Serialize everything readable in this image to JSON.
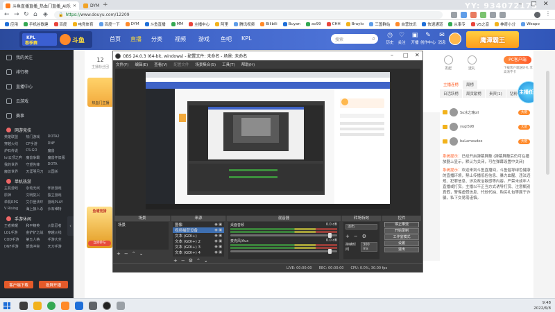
{
  "browser": {
    "tabs": [
      {
        "label": "斗鱼直播直播_热血门直播_AI乐",
        "active": true
      },
      {
        "label": "DYM",
        "active": false
      }
    ],
    "url": "https://www.douyu.com/12209",
    "url_prefix": "https://",
    "url_host": "www.douyu.com/12209",
    "bookmarks": [
      "应用",
      "手机谷歌建",
      "百度",
      "电竞体育",
      "百度一下",
      "DYM",
      "斗鱼直播",
      "MM",
      "主播中心",
      "阿里",
      "腾讯视频",
      "Bilibili",
      "Buyan",
      "av99",
      "CHH",
      "Braylo",
      "三国群站",
      "自营快讯",
      "快速通道",
      "从事专",
      "V5之音",
      "神奇小分",
      "Weapo"
    ]
  },
  "douyu": {
    "nav": [
      "首页",
      "直播",
      "分类",
      "视频",
      "游戏",
      "鱼吧",
      "KPL"
    ],
    "search_placeholder": "搜索",
    "header_icons": [
      "历史",
      "关注",
      "开播",
      "创作中心",
      "消息",
      "直播助手"
    ],
    "banner_right": "鹰潭霸王"
  },
  "sidebar": {
    "items": [
      "我的关注",
      "排行榜",
      "直播中心",
      "云游戏",
      "赛事"
    ],
    "sections": [
      {
        "title": "网游竞技",
        "games": [
          "英雄联盟",
          "热门游戏",
          "DOTA2",
          "穿越火线",
          "CF手游",
          "DNF",
          "炉石传说",
          "CS:GO",
          "魔兽",
          "lol云顶之弈",
          "魔兽争霸",
          "魔兽怀旧服",
          "我的世界",
          "守望先锋",
          "DOTA",
          "魔兽世界",
          "天涯明月刀",
          "三国杀"
        ]
      },
      {
        "title": "单机热游",
        "games": [
          "主机游戏",
          "永劫无间",
          "怀旧游戏",
          "原神",
          "文明复兴",
          "独立游戏",
          "单机RPG",
          "艾尔登法环",
          "游戏PLAY",
          "V Rising",
          "海上狼人杀",
          "沙石维特"
        ]
      },
      {
        "title": "手游休闲",
        "games": [
          "王者荣耀",
          "和平精英",
          "火影忍者",
          "LOL手游",
          "金铲铲之战",
          "穿越火线",
          "COD手游",
          "第五人格",
          "手游大全",
          "DNF手游",
          "部落冲突",
          "天刀手游"
        ]
      }
    ],
    "buttons": [
      "客户端下载",
      "投屏开播"
    ]
  },
  "room": {
    "count": "12",
    "count_label": "主播粉丝团",
    "anchor_label": "热血门主播",
    "gift_title": "鱼塘竞猜",
    "gift_btn": "立即参与"
  },
  "obs": {
    "title": "OBS 24.0.3 (64-bit, windows) - 配置文件: 未命名 - 场景: 未命名",
    "menu": [
      {
        "label": "文件(F)",
        "enabled": true
      },
      {
        "label": "编辑(E)",
        "enabled": true
      },
      {
        "label": "查看(V)",
        "enabled": true
      },
      {
        "label": "配置文件",
        "enabled": false
      },
      {
        "label": "场景集合(S)",
        "enabled": true
      },
      {
        "label": "工具(T)",
        "enabled": true
      },
      {
        "label": "帮助(H)",
        "enabled": true
      }
    ],
    "docks": {
      "scenes": {
        "title": "场景",
        "items": [
          "场景"
        ]
      },
      "sources": {
        "title": "来源",
        "items": [
          "图像",
          "视频捕获设备",
          "文本 (GDI+)",
          "文本 (GDI+) 2",
          "文本 (GDI+) 3",
          "文本 (GDI+) 4"
        ]
      },
      "mixer": {
        "title": "混音器",
        "channels": [
          {
            "name": "桌面音频",
            "db": "0.0 dB"
          },
          {
            "name": "麦克风/Aux",
            "db": "0.0 dB"
          }
        ]
      },
      "transitions": {
        "title": "转场特效",
        "type": "淡出",
        "duration_label": "持续时间",
        "duration": "300 ms"
      },
      "controls": {
        "title": "控件",
        "buttons": [
          "停止推流",
          "开始录制",
          "工作室模式",
          "设置",
          "退出"
        ]
      }
    },
    "status": {
      "live": "LIVE: 00:00:00",
      "rec": "REC: 00:00:00",
      "cpu": "CPU: 0.0%, 30.00 fps"
    }
  },
  "right": {
    "top_icons": [
      "发起",
      "送礼"
    ],
    "pc_button": "PC客户端",
    "pc_sub": "下载客户端送好礼 享高清不卡",
    "tabs1": [
      "主播连榜",
      "周榜"
    ],
    "tabs2": [
      "日活跃榜",
      "周贡献榜",
      "贵宾(1)",
      "钻粉"
    ],
    "fans_badge": "主播任务",
    "fans": [
      {
        "name": "So冰之瑞oll",
        "level": "大佬"
      },
      {
        "name": "yugi598",
        "level": "大佬"
      },
      {
        "name": "baLameadee",
        "level": "大佬"
      }
    ],
    "chat": [
      {
        "tag": "系统提示：",
        "text": "已经开启弹幕屏蔽 (弹幕屏蔽后仍可在播放器上显示，默认为关闭，可在弹幕设置中关闭)"
      },
      {
        "tag": "系统提示：",
        "text": "欢迎来到斗鱼直播间，斗鱼倡导绿色健康的直播环境，禁止传播低俗信息、暴力血腥、违法违规、犯罪信息、涉及政治敏感等内容。严禁未成年人直播或打赏。主播以不正当方式诱导打赏、注意甄别真假，警惕虚假信息、代他代抽、购买礼包等属于诈骗，私下交易需谨慎。"
      }
    ]
  },
  "taskbar": {
    "time": "9:48",
    "date": "2022/6/8"
  },
  "watermark": "YY: 934072175",
  "colors": {
    "douyu_orange": "#ff5d23",
    "douyu_blue": "#3f63c7",
    "obs_bg": "#3b3b3b",
    "sidebar_bg": "#26292e"
  }
}
